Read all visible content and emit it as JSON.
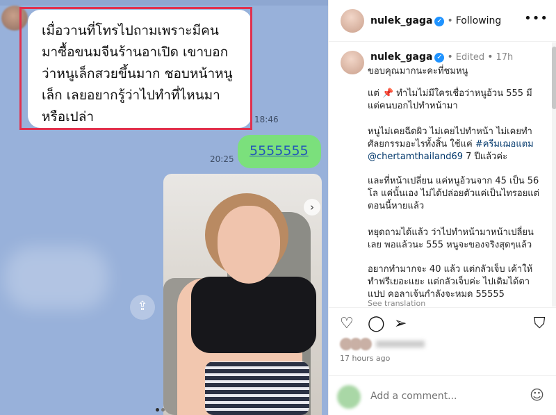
{
  "chat": {
    "incoming_message": "เมื่อวานที่โทรไปถามเพราะมีคน\nมาซื้อขนมจีนร้านอาเปิด เขาบอก\nว่าหนูเล็กสวยขึ้นมาก ชอบหน้าหนู\nเล็ก เลยอยากรู้ว่าไปทำที่ไหนมา\nหรือเปล่า",
    "incoming_time": "18:46",
    "outgoing_message": "5555555",
    "outgoing_time": "20:25"
  },
  "post": {
    "username": "nulek_gaga",
    "follow_status": "Following",
    "edited_label": "Edited",
    "age_short": "17h",
    "caption": [
      "ขอบคุณมากนะคะที่ชมหนู",
      "แต่ 📌 ทำไมไม่มีใครเชื่อว่าหนูอ้วน 555 มีแต่คนบอกไปทำหน้ามา",
      "หนูไม่เคยฉีดผิว ไม่เคยไปทำหน้า ไม่เคยทำศัลยกรรมอะไรทั้งสิ้น ใช้แค่",
      "#ครีมเฌอแตม",
      "@chertamthailand69",
      "7 ปีแล้วค่ะ",
      "และที่หน้าเปลี่ยน แค่หนูอ้วนจาก 45 เป็น 56 โล แค่นั้นเอง ไม่ได้ปล่อยตัวแค่เป็นไทรอยแต่ตอนนี้หายแล้ว",
      "หยุดถามได้แล้ว ว่าไปทำหน้ามาหน้าเปลี่ยนเลย พอแล้วนะ 555 หนูจะของจริงสุดๆแล้ว",
      "อยากทำมากจะ 40 แล้ว แต่กลัวเจ็บ เค้าให้ทำฟรีเยอะแยะ แต่กลัวเจ็บค่ะ ไปเดิมได้ตาแปป คอลาเจ้นกำลังจะหมด 55555"
    ],
    "see_translation": "See translation",
    "time_ago": "17 hours ago",
    "comment_placeholder": "Add a comment..."
  },
  "icons": {
    "verified": "verified-badge-icon",
    "more": "more-options-icon",
    "heart": "heart-icon",
    "comment": "comment-icon",
    "share": "share-icon",
    "save": "bookmark-icon",
    "emoji": "emoji-icon"
  },
  "colors": {
    "chat_bg": "#98b1da",
    "outgoing_bubble": "#7be07c",
    "highlight_border": "#e0314e",
    "verified": "#1f93ff",
    "hashtag": "#00376b"
  }
}
